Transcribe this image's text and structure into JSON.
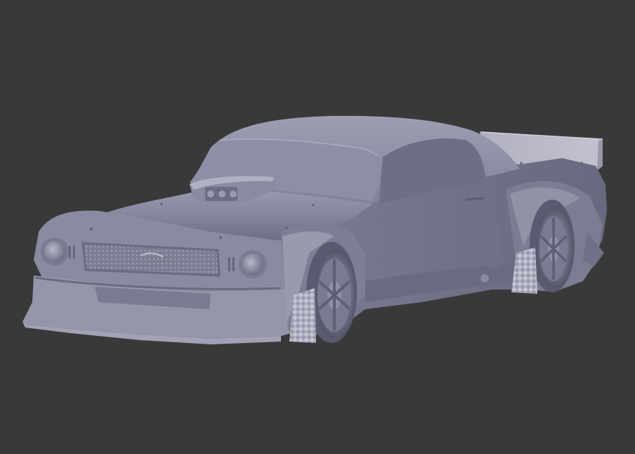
{
  "viewport": {
    "background_color": "#393939",
    "model_color": "#8a8aa2",
    "model_shadow_color": "#5d5d70",
    "model_highlight_color": "#b2b2c4"
  },
  "model": {
    "icons": [
      "car-model-icon"
    ]
  }
}
